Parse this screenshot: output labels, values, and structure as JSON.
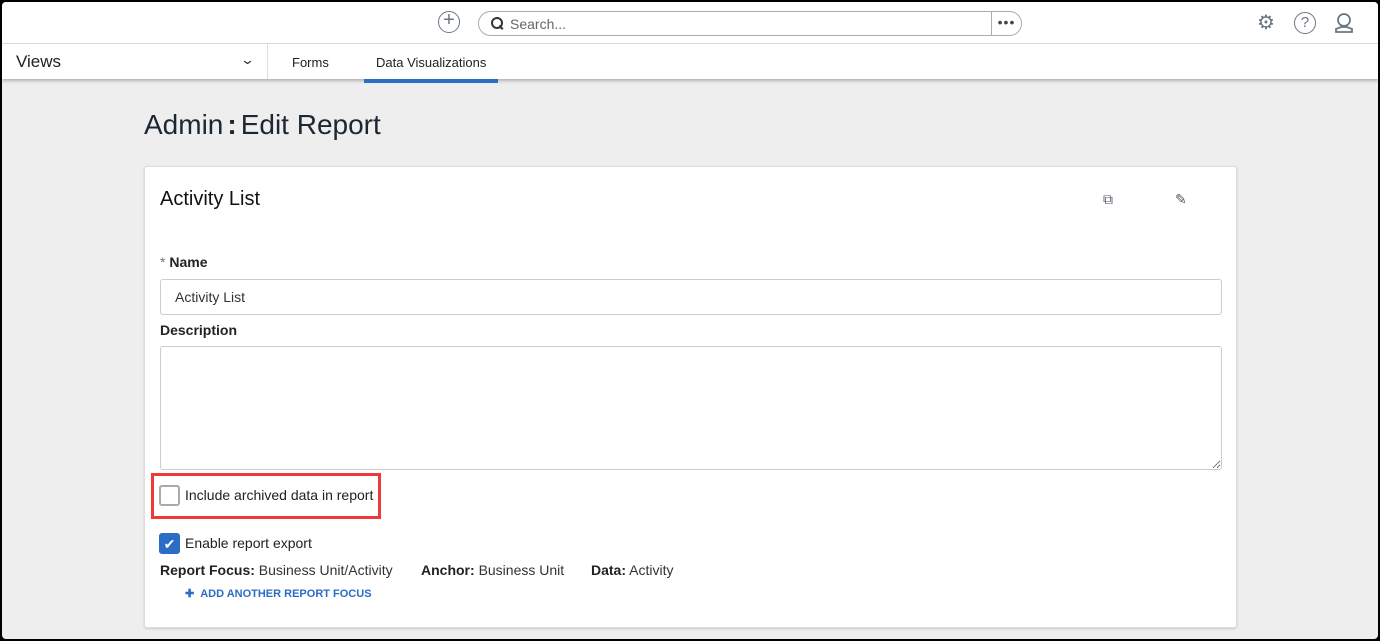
{
  "topbar": {
    "search_placeholder": "Search...",
    "more": "•••"
  },
  "nav": {
    "views": "Views",
    "tabs": [
      {
        "label": "Forms"
      },
      {
        "label": "Data Visualizations",
        "active": true
      }
    ]
  },
  "page": {
    "title_prefix": "Admin",
    "title_sep": ":",
    "title": "Edit Report"
  },
  "card": {
    "title": "Activity List",
    "name_required": "*",
    "name_label": "Name",
    "name_value": "Activity List",
    "description_label": "Description",
    "description_value": "",
    "include_archived_label": "Include archived data in report",
    "include_archived_checked": false,
    "enable_export_label": "Enable report export",
    "enable_export_checked": true,
    "report_focus_label": "Report Focus:",
    "report_focus_value": "Business Unit/Activity",
    "anchor_label": "Anchor:",
    "anchor_value": "Business Unit",
    "data_label": "Data:",
    "data_value": "Activity",
    "add_focus": "ADD ANOTHER REPORT FOCUS"
  },
  "colors": {
    "accent": "#2b6cc4",
    "highlight": "#f0393b"
  }
}
